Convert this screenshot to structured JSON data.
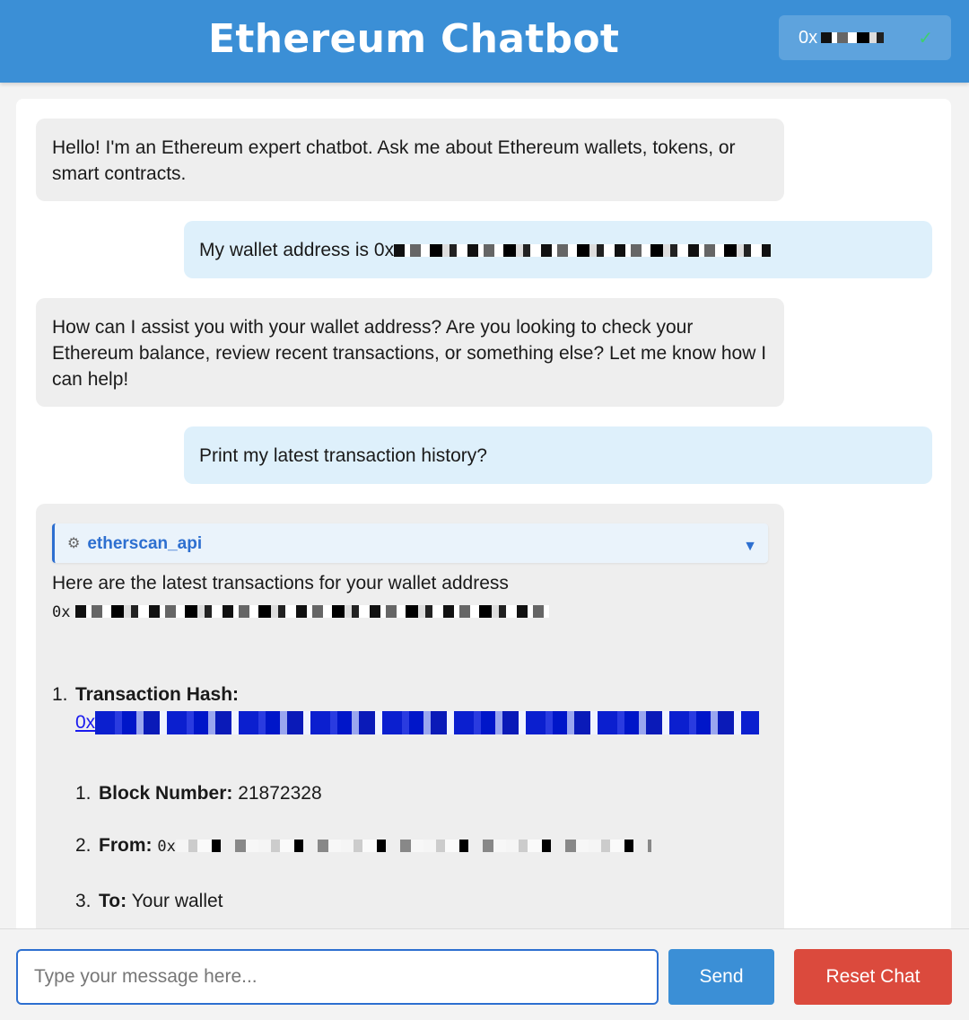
{
  "header": {
    "title": "Ethereum Chatbot",
    "wallet_prefix": "0x",
    "connected_icon": "check-icon"
  },
  "messages": [
    {
      "role": "bot",
      "text": "Hello! I'm an Ethereum expert chatbot. Ask me about Ethereum wallets, tokens, or smart contracts."
    },
    {
      "role": "user",
      "text": "My wallet address is 0x"
    },
    {
      "role": "bot",
      "text": "How can I assist you with your wallet address? Are you looking to check your Ethereum balance, review recent transactions, or something else? Let me know how I can help!"
    },
    {
      "role": "user",
      "text": "Print my latest transaction history?"
    }
  ],
  "tool_response": {
    "tool_icon": "gear-icon",
    "tool_name": "etherscan_api",
    "intro": "Here are the latest transactions for your wallet address",
    "address_prefix": "0x",
    "transactions": [
      {
        "index": "1.",
        "hash_label": "Transaction Hash:",
        "hash_prefix": "0x",
        "details": [
          {
            "index": "1.",
            "label": "Block Number:",
            "value": "21872328"
          },
          {
            "index": "2.",
            "label": "From:",
            "value": "0x"
          },
          {
            "index": "3.",
            "label": "To:",
            "value": "Your wallet"
          }
        ]
      }
    ]
  },
  "composer": {
    "placeholder": "Type your message here...",
    "send_label": "Send",
    "reset_label": "Reset Chat"
  },
  "colors": {
    "header": "#3b8fd6",
    "user_bubble": "#def0fb",
    "bot_bubble": "#eeeeee",
    "send_button": "#3b8fd6",
    "reset_button": "#db4a3d",
    "link": "#1a1aee"
  }
}
